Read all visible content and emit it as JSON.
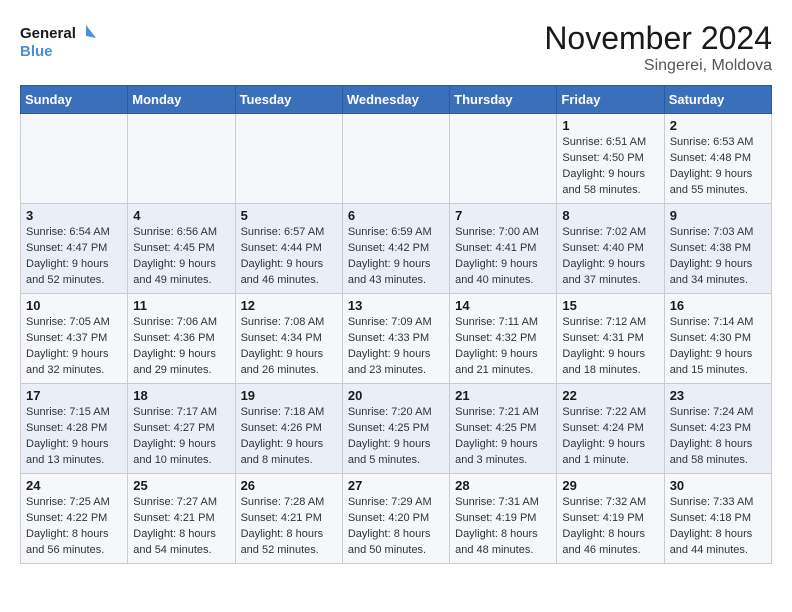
{
  "header": {
    "logo_line1": "General",
    "logo_line2": "Blue",
    "month_title": "November 2024",
    "location": "Singerei, Moldova"
  },
  "days_of_week": [
    "Sunday",
    "Monday",
    "Tuesday",
    "Wednesday",
    "Thursday",
    "Friday",
    "Saturday"
  ],
  "weeks": [
    [
      {
        "day": "",
        "info": ""
      },
      {
        "day": "",
        "info": ""
      },
      {
        "day": "",
        "info": ""
      },
      {
        "day": "",
        "info": ""
      },
      {
        "day": "",
        "info": ""
      },
      {
        "day": "1",
        "info": "Sunrise: 6:51 AM\nSunset: 4:50 PM\nDaylight: 9 hours and 58 minutes."
      },
      {
        "day": "2",
        "info": "Sunrise: 6:53 AM\nSunset: 4:48 PM\nDaylight: 9 hours and 55 minutes."
      }
    ],
    [
      {
        "day": "3",
        "info": "Sunrise: 6:54 AM\nSunset: 4:47 PM\nDaylight: 9 hours and 52 minutes."
      },
      {
        "day": "4",
        "info": "Sunrise: 6:56 AM\nSunset: 4:45 PM\nDaylight: 9 hours and 49 minutes."
      },
      {
        "day": "5",
        "info": "Sunrise: 6:57 AM\nSunset: 4:44 PM\nDaylight: 9 hours and 46 minutes."
      },
      {
        "day": "6",
        "info": "Sunrise: 6:59 AM\nSunset: 4:42 PM\nDaylight: 9 hours and 43 minutes."
      },
      {
        "day": "7",
        "info": "Sunrise: 7:00 AM\nSunset: 4:41 PM\nDaylight: 9 hours and 40 minutes."
      },
      {
        "day": "8",
        "info": "Sunrise: 7:02 AM\nSunset: 4:40 PM\nDaylight: 9 hours and 37 minutes."
      },
      {
        "day": "9",
        "info": "Sunrise: 7:03 AM\nSunset: 4:38 PM\nDaylight: 9 hours and 34 minutes."
      }
    ],
    [
      {
        "day": "10",
        "info": "Sunrise: 7:05 AM\nSunset: 4:37 PM\nDaylight: 9 hours and 32 minutes."
      },
      {
        "day": "11",
        "info": "Sunrise: 7:06 AM\nSunset: 4:36 PM\nDaylight: 9 hours and 29 minutes."
      },
      {
        "day": "12",
        "info": "Sunrise: 7:08 AM\nSunset: 4:34 PM\nDaylight: 9 hours and 26 minutes."
      },
      {
        "day": "13",
        "info": "Sunrise: 7:09 AM\nSunset: 4:33 PM\nDaylight: 9 hours and 23 minutes."
      },
      {
        "day": "14",
        "info": "Sunrise: 7:11 AM\nSunset: 4:32 PM\nDaylight: 9 hours and 21 minutes."
      },
      {
        "day": "15",
        "info": "Sunrise: 7:12 AM\nSunset: 4:31 PM\nDaylight: 9 hours and 18 minutes."
      },
      {
        "day": "16",
        "info": "Sunrise: 7:14 AM\nSunset: 4:30 PM\nDaylight: 9 hours and 15 minutes."
      }
    ],
    [
      {
        "day": "17",
        "info": "Sunrise: 7:15 AM\nSunset: 4:28 PM\nDaylight: 9 hours and 13 minutes."
      },
      {
        "day": "18",
        "info": "Sunrise: 7:17 AM\nSunset: 4:27 PM\nDaylight: 9 hours and 10 minutes."
      },
      {
        "day": "19",
        "info": "Sunrise: 7:18 AM\nSunset: 4:26 PM\nDaylight: 9 hours and 8 minutes."
      },
      {
        "day": "20",
        "info": "Sunrise: 7:20 AM\nSunset: 4:25 PM\nDaylight: 9 hours and 5 minutes."
      },
      {
        "day": "21",
        "info": "Sunrise: 7:21 AM\nSunset: 4:25 PM\nDaylight: 9 hours and 3 minutes."
      },
      {
        "day": "22",
        "info": "Sunrise: 7:22 AM\nSunset: 4:24 PM\nDaylight: 9 hours and 1 minute."
      },
      {
        "day": "23",
        "info": "Sunrise: 7:24 AM\nSunset: 4:23 PM\nDaylight: 8 hours and 58 minutes."
      }
    ],
    [
      {
        "day": "24",
        "info": "Sunrise: 7:25 AM\nSunset: 4:22 PM\nDaylight: 8 hours and 56 minutes."
      },
      {
        "day": "25",
        "info": "Sunrise: 7:27 AM\nSunset: 4:21 PM\nDaylight: 8 hours and 54 minutes."
      },
      {
        "day": "26",
        "info": "Sunrise: 7:28 AM\nSunset: 4:21 PM\nDaylight: 8 hours and 52 minutes."
      },
      {
        "day": "27",
        "info": "Sunrise: 7:29 AM\nSunset: 4:20 PM\nDaylight: 8 hours and 50 minutes."
      },
      {
        "day": "28",
        "info": "Sunrise: 7:31 AM\nSunset: 4:19 PM\nDaylight: 8 hours and 48 minutes."
      },
      {
        "day": "29",
        "info": "Sunrise: 7:32 AM\nSunset: 4:19 PM\nDaylight: 8 hours and 46 minutes."
      },
      {
        "day": "30",
        "info": "Sunrise: 7:33 AM\nSunset: 4:18 PM\nDaylight: 8 hours and 44 minutes."
      }
    ]
  ]
}
